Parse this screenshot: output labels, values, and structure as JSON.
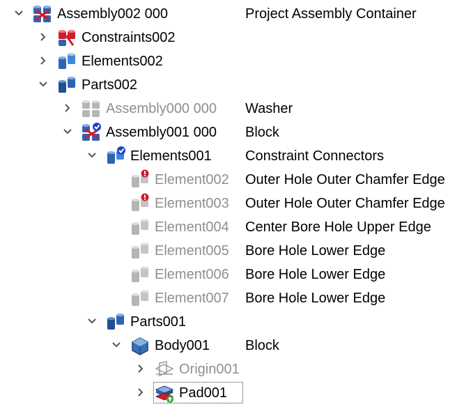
{
  "tree": {
    "rows": [
      {
        "label": "Assembly002 000",
        "desc": "Project Assembly Container",
        "icon": "assembly-icon"
      },
      {
        "label": "Constraints002",
        "desc": "",
        "icon": "constraints-icon"
      },
      {
        "label": "Elements002",
        "desc": "",
        "icon": "elements-icon"
      },
      {
        "label": "Parts002",
        "desc": "",
        "icon": "parts-icon"
      },
      {
        "label": "Assembly000 000",
        "desc": "Washer",
        "icon": "assembly-grey-icon"
      },
      {
        "label": "Assembly001 000",
        "desc": "Block",
        "icon": "assembly-check-icon"
      },
      {
        "label": "Elements001",
        "desc": "Constraint Connectors",
        "icon": "elements-check-icon"
      },
      {
        "label": "Element002",
        "desc": "Outer Hole Outer Chamfer Edge",
        "icon": "element-error-icon"
      },
      {
        "label": "Element003",
        "desc": "Outer Hole Outer Chamfer Edge",
        "icon": "element-error-icon"
      },
      {
        "label": "Element004",
        "desc": "Center Bore Hole Upper Edge",
        "icon": "element-icon"
      },
      {
        "label": "Element005",
        "desc": "Bore Hole Lower Edge",
        "icon": "element-icon"
      },
      {
        "label": "Element006",
        "desc": "Bore Hole Lower Edge",
        "icon": "element-icon"
      },
      {
        "label": "Element007",
        "desc": "Bore Hole Lower Edge",
        "icon": "element-icon"
      },
      {
        "label": "Parts001",
        "desc": "",
        "icon": "parts-icon"
      },
      {
        "label": "Body001",
        "desc": "Block",
        "icon": "body-icon"
      },
      {
        "label": "Origin001",
        "desc": "",
        "icon": "origin-icon"
      },
      {
        "label": "Pad001",
        "desc": "",
        "icon": "pad-icon"
      }
    ]
  },
  "colors": {
    "blue": "#2e64b0",
    "red": "#d01b2c",
    "grey": "#b5b5b5",
    "dim_text": "#8f8f8f"
  }
}
